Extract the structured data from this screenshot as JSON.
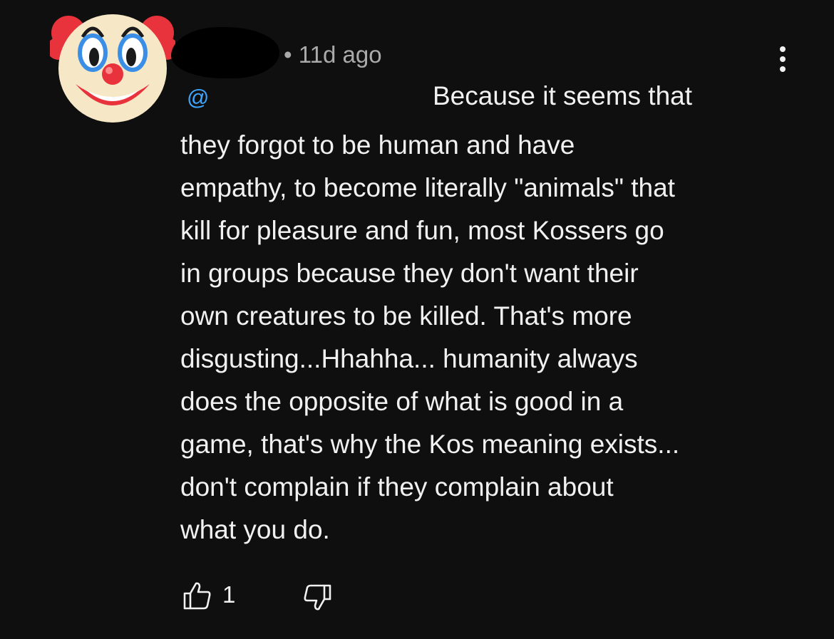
{
  "comment": {
    "avatar_icon": "clown-face-icon",
    "meta": "• 11d ago",
    "mention": "@",
    "first_line": "Because it seems that",
    "body": "they forgot to be human and have\nempathy, to become literally \"animals\" that\nkill for pleasure and fun, most Kossers go\nin groups because they don't want their\nown creatures to be killed. That's more\ndisgusting...Hhahha... humanity always\ndoes the opposite of what is good in a\ngame, that's why the Kos meaning exists...\ndon't complain if they complain about\nwhat you do.",
    "like_count": "1",
    "more_icon": "more-vertical-icon",
    "like_icon": "thumbs-up-icon",
    "dislike_icon": "thumbs-down-icon"
  },
  "colors": {
    "background": "#0f0f0f",
    "text": "#f1f1f1",
    "meta_text": "#aaaaaa",
    "mention": "#3ea6ff"
  }
}
